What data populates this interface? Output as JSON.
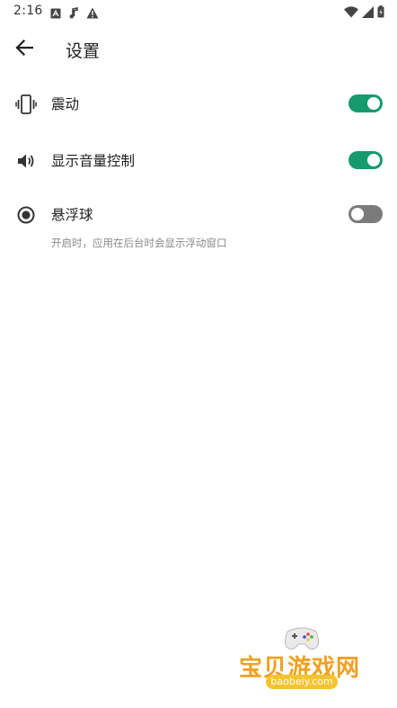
{
  "statusbar": {
    "time": "2:16",
    "icons_left": [
      "a-icon",
      "music-note-icon",
      "warning-icon"
    ],
    "icons_right": [
      "wifi-icon",
      "signal-icon",
      "battery-icon"
    ]
  },
  "appbar": {
    "back_icon": "arrow-left-icon",
    "title": "设置"
  },
  "settings": [
    {
      "icon": "phone-vibrate-icon",
      "label": "震动",
      "toggle": true
    },
    {
      "icon": "speaker-icon",
      "label": "显示音量控制",
      "toggle": true
    },
    {
      "icon": "radio-dot-icon",
      "label": "悬浮球",
      "toggle": false,
      "description": "开启时，应用在后台时会显示浮动窗口"
    }
  ],
  "watermark": {
    "text": "宝贝游戏网",
    "domain": "baobeiy.com"
  },
  "colors": {
    "toggle_on": "#169a6e",
    "toggle_off": "#7b7b7b",
    "watermark": "#f0a020"
  }
}
